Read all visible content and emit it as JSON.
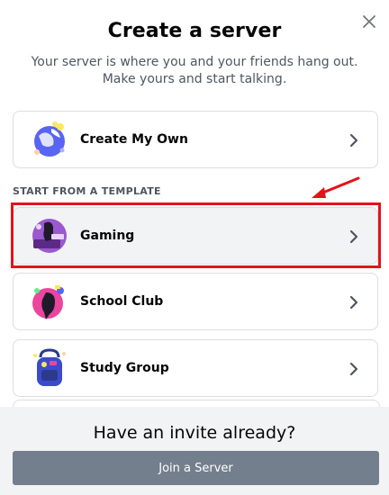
{
  "dialog": {
    "title": "Create a server",
    "subtitle": "Your server is where you and your friends hang out. Make yours and start talking."
  },
  "options": {
    "create_own": {
      "label": "Create My Own",
      "icon": "globe-icon"
    },
    "section_title": "START FROM A TEMPLATE",
    "templates": [
      {
        "label": "Gaming",
        "icon": "gaming-icon"
      },
      {
        "label": "School Club",
        "icon": "school-club-icon"
      },
      {
        "label": "Study Group",
        "icon": "backpack-icon"
      }
    ]
  },
  "footer": {
    "title": "Have an invite already?",
    "join_label": "Join a Server"
  },
  "colors": {
    "highlight": "#e3131b",
    "join_button": "#747f8d",
    "footer_bg": "#f2f3f5"
  }
}
